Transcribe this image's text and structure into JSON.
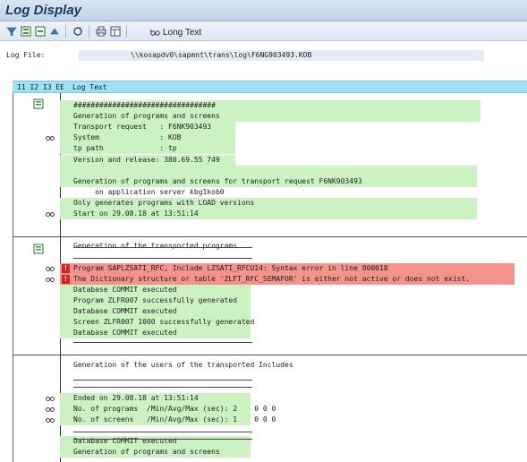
{
  "window": {
    "title": "Log Display"
  },
  "toolbar": {
    "long_text_label": "Long Text"
  },
  "logfile": {
    "label": "Log File:",
    "value": "\\\\kosapdv0\\sapmnt\\trans\\log\\F6NG903493.KOB"
  },
  "header": {
    "cols": "I1 I2 I3 EE",
    "log_text": "Log Text"
  },
  "rows": [
    {
      "text": "#################################",
      "bg": "green",
      "icon": ""
    },
    {
      "text": "Generation of programs and screens",
      "bg": "green",
      "icon": ""
    },
    {
      "text": "Transport request   : F6NK903493",
      "bg": "green",
      "icon": ""
    },
    {
      "text": "System              : KOB",
      "bg": "green",
      "icon": "glasses"
    },
    {
      "text": "tp path             : tp",
      "bg": "green",
      "icon": ""
    },
    {
      "text": "Version and release: 380.69.55 749",
      "bg": "green",
      "icon": ""
    },
    {
      "text": "",
      "bg": "green",
      "icon": ""
    },
    {
      "text": "Generation of programs and screens for transport request F6NK903493",
      "bg": "green",
      "icon": ""
    },
    {
      "text": "     on application server kbg1kob0",
      "bg": "white",
      "icon": ""
    },
    {
      "text": "Only generates programs with LOAD versions",
      "bg": "green",
      "icon": ""
    },
    {
      "text": "Start on 29.08.18 at 13:51:14",
      "bg": "green",
      "icon": "glasses"
    },
    {
      "text": "",
      "bg": "white",
      "icon": ""
    },
    {
      "text": "",
      "bg": "white",
      "icon": ""
    },
    {
      "text": "Generation of the transported programs",
      "bg": "white",
      "icon": ""
    },
    {
      "text": "",
      "bg": "white",
      "icon": ""
    },
    {
      "text": "Program SAPLZSATI_RFC, Include LZSATI_RFCU14: Syntax error in line 000018",
      "bg": "red",
      "icon": "glasses",
      "error": "!"
    },
    {
      "text": "The Dictionary structure or table 'ZLFT_RFC_SEMAFOR' is either not active or does not exist.",
      "bg": "red",
      "icon": "glasses",
      "error": "!"
    },
    {
      "text": "Database COMMIT executed",
      "bg": "green",
      "icon": ""
    },
    {
      "text": "Program ZLFR007 successfully generated",
      "bg": "green",
      "icon": ""
    },
    {
      "text": "Database COMMIT executed",
      "bg": "green",
      "icon": ""
    },
    {
      "text": "Screen ZLFR007 1000 successfully generated",
      "bg": "green",
      "icon": ""
    },
    {
      "text": "Database COMMIT executed",
      "bg": "green",
      "icon": ""
    },
    {
      "text": "",
      "bg": "white",
      "icon": ""
    },
    {
      "text": "",
      "bg": "white",
      "icon": ""
    },
    {
      "text": "Generation of the users of the transported Includes",
      "bg": "white",
      "icon": ""
    },
    {
      "text": "",
      "bg": "white",
      "icon": ""
    },
    {
      "text": "",
      "bg": "white",
      "icon": ""
    },
    {
      "text": "Ended on 29.08.18 at 13:51:14",
      "bg": "green",
      "icon": "glasses"
    },
    {
      "text": "No. of programs  /Min/Avg/Max (sec): 2    0 0 0",
      "bg": "green",
      "icon": "glasses"
    },
    {
      "text": "No. of screens   /Min/Avg/Max (sec): 1    0 0 0",
      "bg": "green",
      "icon": "glasses"
    },
    {
      "text": "",
      "bg": "white",
      "icon": ""
    },
    {
      "text": "Database COMMIT executed",
      "bg": "green",
      "icon": ""
    },
    {
      "text": "Generation of programs and screens",
      "bg": "green",
      "icon": ""
    }
  ],
  "colors": {
    "green": "#ccf2c4",
    "red": "#f3938c",
    "header": "#9ee1f2"
  }
}
